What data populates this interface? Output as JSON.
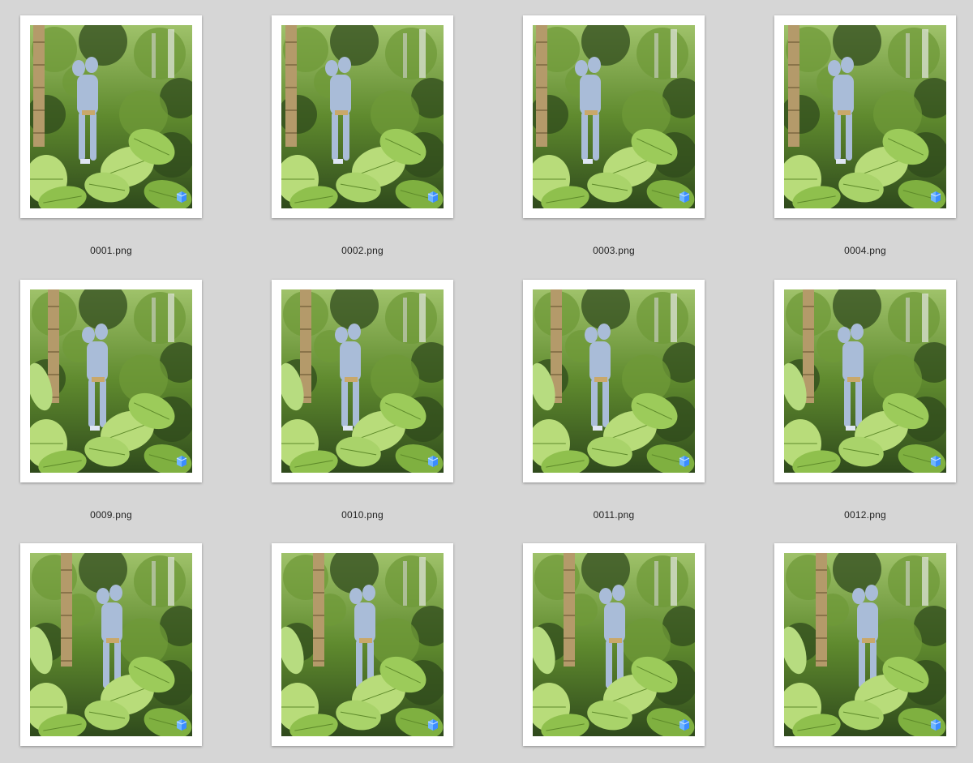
{
  "files": [
    {
      "name": "0001.png",
      "thumbnail": "avatar-statue-jungle-photo",
      "badge_icon": "layers-icon"
    },
    {
      "name": "0002.png",
      "thumbnail": "avatar-statue-jungle-photo",
      "badge_icon": "layers-icon"
    },
    {
      "name": "0003.png",
      "thumbnail": "avatar-statue-jungle-photo",
      "badge_icon": "layers-icon"
    },
    {
      "name": "0004.png",
      "thumbnail": "avatar-statue-jungle-photo",
      "badge_icon": "layers-icon"
    },
    {
      "name": "0009.png",
      "thumbnail": "avatar-statue-jungle-photo",
      "badge_icon": "layers-icon"
    },
    {
      "name": "0010.png",
      "thumbnail": "avatar-statue-jungle-photo",
      "badge_icon": "layers-icon"
    },
    {
      "name": "0011.png",
      "thumbnail": "avatar-statue-jungle-photo",
      "badge_icon": "layers-icon"
    },
    {
      "name": "0012.png",
      "thumbnail": "avatar-statue-jungle-photo",
      "badge_icon": "layers-icon"
    },
    {
      "name": "",
      "thumbnail": "avatar-statue-jungle-photo",
      "badge_icon": "layers-icon"
    },
    {
      "name": "",
      "thumbnail": "avatar-statue-jungle-photo",
      "badge_icon": "layers-icon"
    },
    {
      "name": "",
      "thumbnail": "avatar-statue-jungle-photo",
      "badge_icon": "layers-icon"
    },
    {
      "name": "",
      "thumbnail": "avatar-statue-jungle-photo",
      "badge_icon": "layers-icon"
    }
  ],
  "colors": {
    "background": "#d6d6d6",
    "frame": "#ffffff",
    "foliage_dark": "#2f4a1c",
    "foliage_mid": "#5f8a2e",
    "foliage_light": "#b8dc7a",
    "figure": "#a9bcd8",
    "bamboo": "#b49a6a",
    "badge": "#3b8cff"
  }
}
